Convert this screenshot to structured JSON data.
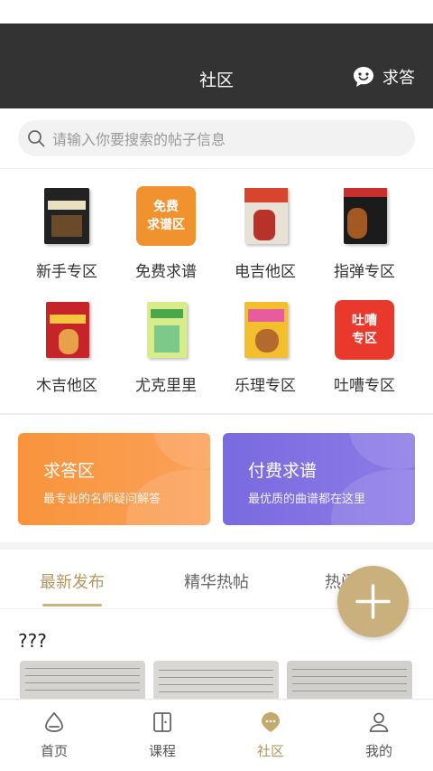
{
  "header": {
    "title": "社区",
    "ask_label": "求答"
  },
  "search": {
    "placeholder": "请输入你要搜索的帖子信息"
  },
  "categories": [
    {
      "label": "新手专区"
    },
    {
      "label": "免费求谱",
      "tile": [
        "免费",
        "求谱区"
      ]
    },
    {
      "label": "电吉他区"
    },
    {
      "label": "指弹专区"
    },
    {
      "label": "木吉他区"
    },
    {
      "label": "尤克里里"
    },
    {
      "label": "乐理专区"
    },
    {
      "label": "吐嘈专区",
      "tile": [
        "吐嘈",
        "专区"
      ]
    }
  ],
  "cards": [
    {
      "title": "求答区",
      "subtitle": "最专业的名师疑问解答",
      "color": "#f7923a"
    },
    {
      "title": "付费求谱",
      "subtitle": "最优质的曲谱都在这里",
      "color": "#7b6be0"
    }
  ],
  "tabs": [
    {
      "label": "最新发布",
      "active": true
    },
    {
      "label": "精华热帖",
      "active": false
    },
    {
      "label": "热门",
      "active": false
    }
  ],
  "post": {
    "title": "???"
  },
  "bottom_nav": [
    {
      "label": "首页",
      "icon": "home-icon",
      "active": false
    },
    {
      "label": "课程",
      "icon": "course-icon",
      "active": false
    },
    {
      "label": "社区",
      "icon": "community-icon",
      "active": true
    },
    {
      "label": "我的",
      "icon": "profile-icon",
      "active": false
    }
  ],
  "colors": {
    "accent": "#b29860",
    "fab": "#c9b07c",
    "header": "#333333"
  }
}
